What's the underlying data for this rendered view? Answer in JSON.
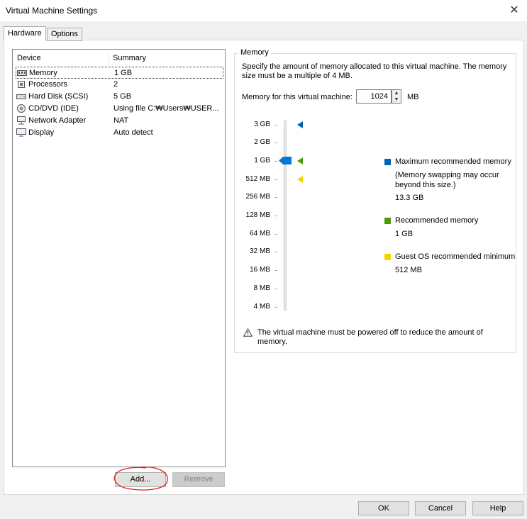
{
  "window": {
    "title": "Virtual Machine Settings"
  },
  "tabs": [
    {
      "label": "Hardware",
      "active": true
    },
    {
      "label": "Options",
      "active": false
    }
  ],
  "device_list": {
    "columns": [
      "Device",
      "Summary"
    ],
    "rows": [
      {
        "icon": "memory-icon",
        "name": "Memory",
        "summary": "1 GB",
        "selected": true
      },
      {
        "icon": "processor-icon",
        "name": "Processors",
        "summary": "2"
      },
      {
        "icon": "hard-disk-icon",
        "name": "Hard Disk (SCSI)",
        "summary": "5 GB"
      },
      {
        "icon": "cd-dvd-icon",
        "name": "CD/DVD (IDE)",
        "summary": "Using file C:₩Users₩USER..."
      },
      {
        "icon": "network-adapter-icon",
        "name": "Network Adapter",
        "summary": "NAT"
      },
      {
        "icon": "display-icon",
        "name": "Display",
        "summary": "Auto detect"
      }
    ],
    "add_label": "Add...",
    "remove_label": "Remove"
  },
  "memory": {
    "group_title": "Memory",
    "description": "Specify the amount of memory allocated to this virtual machine. The memory size must be a multiple of 4 MB.",
    "field_label": "Memory for this virtual machine:",
    "value": "1024",
    "unit": "MB",
    "scale": [
      "3 GB",
      "2 GB",
      "1 GB",
      "512 MB",
      "256 MB",
      "128 MB",
      "64 MB",
      "32 MB",
      "16 MB",
      "8 MB",
      "4 MB"
    ],
    "legend": {
      "max_title": "Maximum recommended memory",
      "max_note": "(Memory swapping may occur beyond this size.)",
      "max_value": "13.3 GB",
      "rec_title": "Recommended memory",
      "rec_value": "1 GB",
      "guest_title": "Guest OS recommended minimum",
      "guest_value": "512 MB"
    },
    "warning": "The virtual machine must be powered off to reduce the amount of memory."
  },
  "colors": {
    "max": "#0063b1",
    "rec": "#4e9a06",
    "guest": "#f2d600",
    "accent": "#0078d7"
  },
  "buttons": {
    "ok": "OK",
    "cancel": "Cancel",
    "help": "Help"
  }
}
